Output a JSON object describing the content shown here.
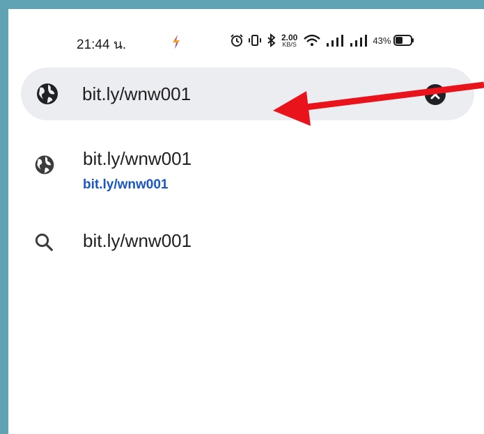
{
  "status_bar": {
    "time": "21:44 น.",
    "net_speed_value": "2.00",
    "net_speed_unit": "KB/S",
    "battery_percent": "43%"
  },
  "search": {
    "value": "bit.ly/wnw001"
  },
  "suggestions": [
    {
      "icon": "globe-icon",
      "title": "bit.ly/wnw001",
      "url": "bit.ly/wnw001"
    },
    {
      "icon": "search-icon",
      "title": "bit.ly/wnw001"
    }
  ],
  "colors": {
    "background": "#ffffff",
    "border": "#5fa3b5",
    "search_pill": "#ecedf1",
    "link_blue": "#1a57c4",
    "annotation_arrow": "#e8131b"
  }
}
